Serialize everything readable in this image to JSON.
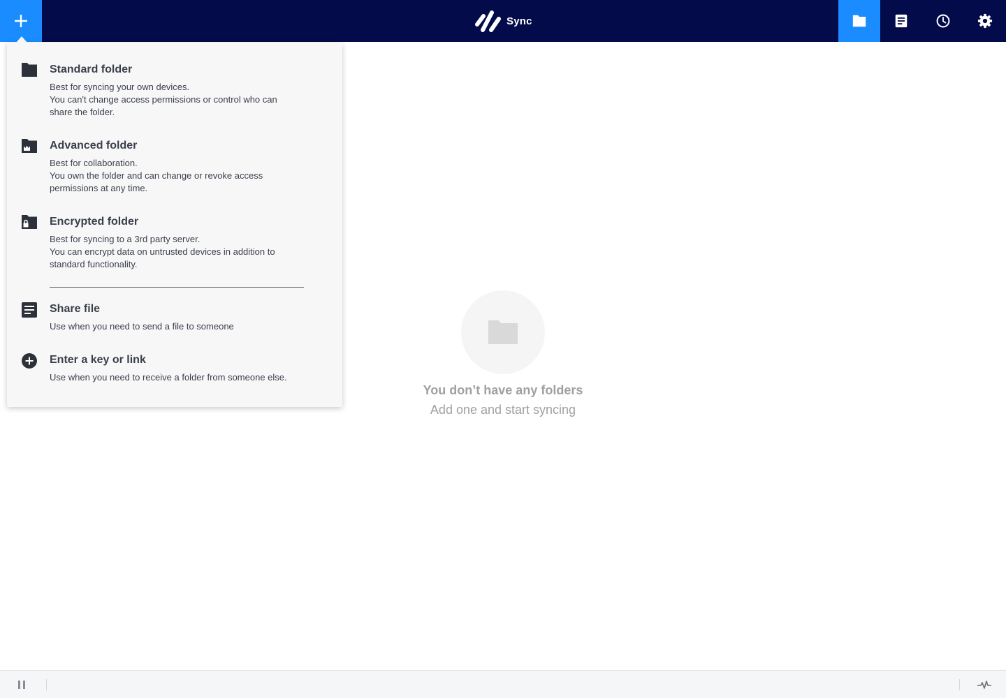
{
  "app": {
    "name": "Sync"
  },
  "topbar": {
    "add_icon": "plus-icon",
    "nav": [
      {
        "id": "folders",
        "icon": "folder-icon",
        "active": true
      },
      {
        "id": "files",
        "icon": "document-icon",
        "active": false
      },
      {
        "id": "history",
        "icon": "clock-icon",
        "active": false
      },
      {
        "id": "settings",
        "icon": "gear-icon",
        "active": false
      }
    ]
  },
  "add_menu": {
    "items": [
      {
        "title": "Standard folder",
        "icon": "folder-icon",
        "desc": [
          "Best for syncing your own devices.",
          "You can't change access permissions or control who can",
          "share the folder."
        ]
      },
      {
        "title": "Advanced folder",
        "icon": "folder-crown-icon",
        "desc": [
          "Best for collaboration.",
          "You own the folder and can change or revoke access",
          "permissions at any time."
        ]
      },
      {
        "title": "Encrypted folder",
        "icon": "folder-lock-icon",
        "desc": [
          "Best for syncing to a 3rd party server.",
          "You can encrypt data on untrusted devices in addition to",
          "standard functionality."
        ]
      },
      {
        "title": "Share file",
        "icon": "document-icon",
        "desc": [
          "Use when you need to send a file to someone"
        ]
      },
      {
        "title": "Enter a key or link",
        "icon": "plus-circle-icon",
        "desc": [
          "Use when you need to receive a folder from someone else."
        ]
      }
    ]
  },
  "empty_state": {
    "icon": "folder-icon",
    "title": "You don’t have any folders",
    "subtitle": "Add one and start syncing"
  },
  "bottombar": {
    "pause_icon": "pause-icon",
    "activity_icon": "activity-icon"
  },
  "colors": {
    "topbar_bg": "#030b4a",
    "accent": "#1a8cff",
    "menu_bg": "#f7f7f8",
    "menu_text": "#3a3f4a",
    "empty_text": "#a0a0a0"
  }
}
